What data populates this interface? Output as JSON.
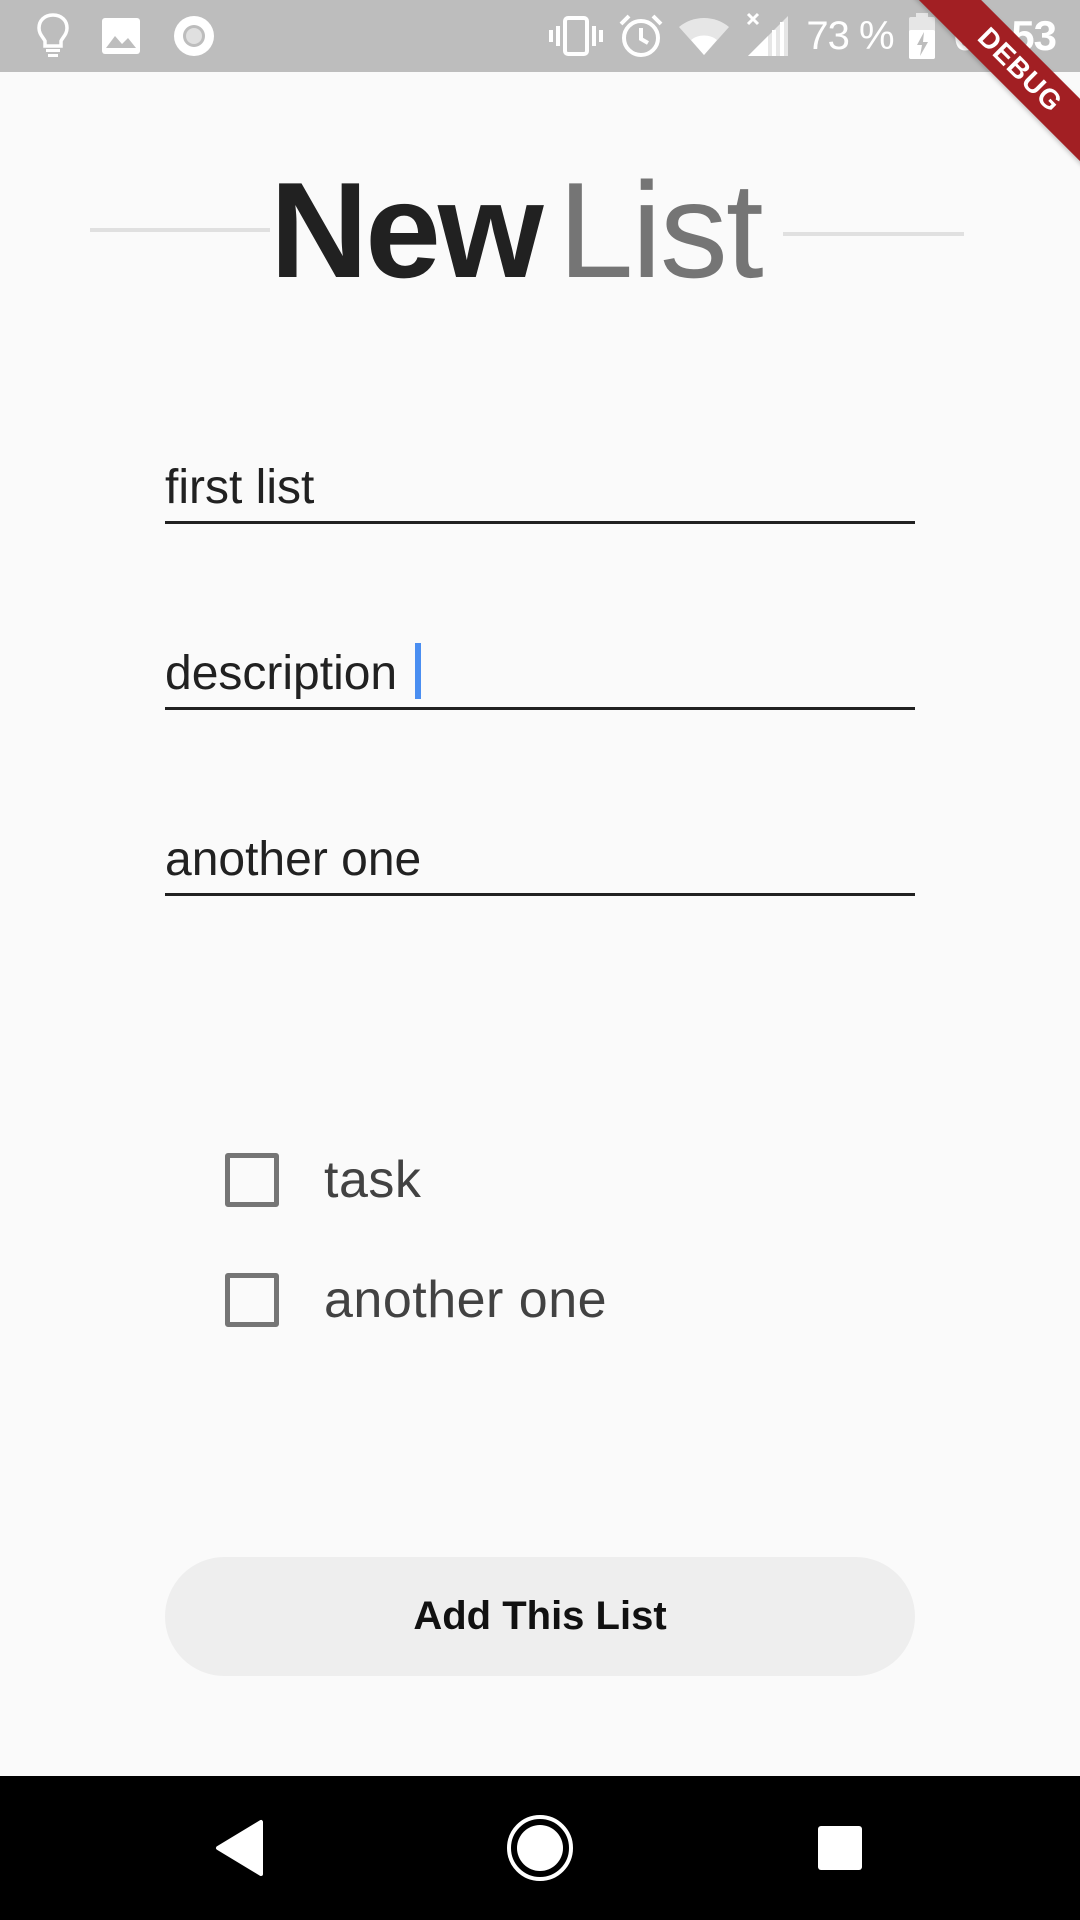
{
  "status_bar": {
    "left_icons": [
      "lightbulb-icon",
      "image-icon",
      "record-icon"
    ],
    "right_icons": [
      "vibrate-icon",
      "alarm-icon",
      "wifi-icon",
      "signal-icon"
    ],
    "battery_percent": "73 %",
    "time": "02:53"
  },
  "debug_banner": "DEBUG",
  "title": {
    "bold": "New",
    "light": "List"
  },
  "fields": [
    {
      "value": "first list"
    },
    {
      "value": "description "
    },
    {
      "value": "another one"
    }
  ],
  "tasks": [
    {
      "label": "task",
      "checked": false
    },
    {
      "label": "another one",
      "checked": false
    }
  ],
  "add_button": {
    "label": "Add This List"
  },
  "nav_bar": {
    "icons": [
      "back-icon",
      "home-icon",
      "recents-icon"
    ]
  },
  "colors": {
    "status_bar": "#bdbdbd",
    "background": "#fafafa",
    "cursor": "#4a8ef1",
    "button_bg": "#eeeeee",
    "debug_ribbon": "#a21f23"
  }
}
